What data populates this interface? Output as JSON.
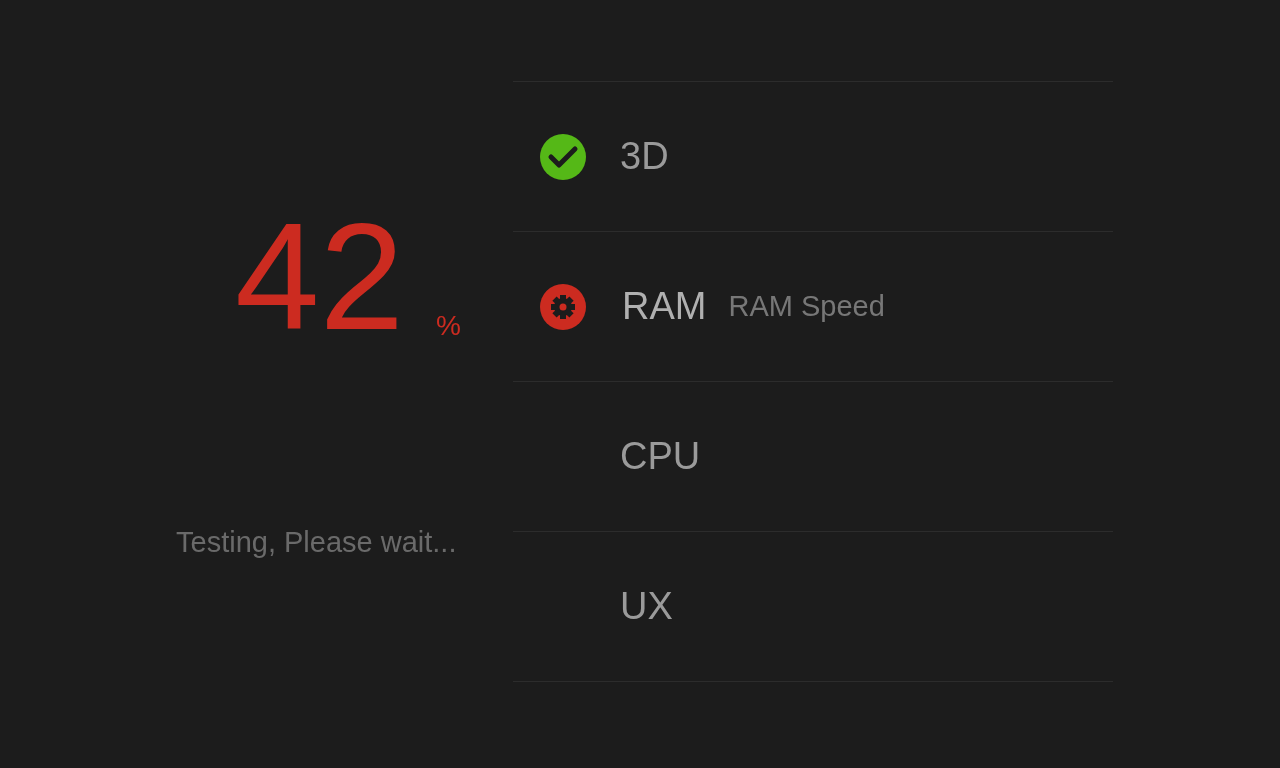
{
  "progress": {
    "value": "42",
    "unit": "%",
    "message": "Testing, Please wait..."
  },
  "tests": [
    {
      "name": "3D",
      "kind": "done"
    },
    {
      "name": "RAM",
      "kind": "running",
      "detail": "RAM Speed"
    },
    {
      "name": "CPU",
      "kind": "pending"
    },
    {
      "name": "UX",
      "kind": "pending"
    }
  ]
}
